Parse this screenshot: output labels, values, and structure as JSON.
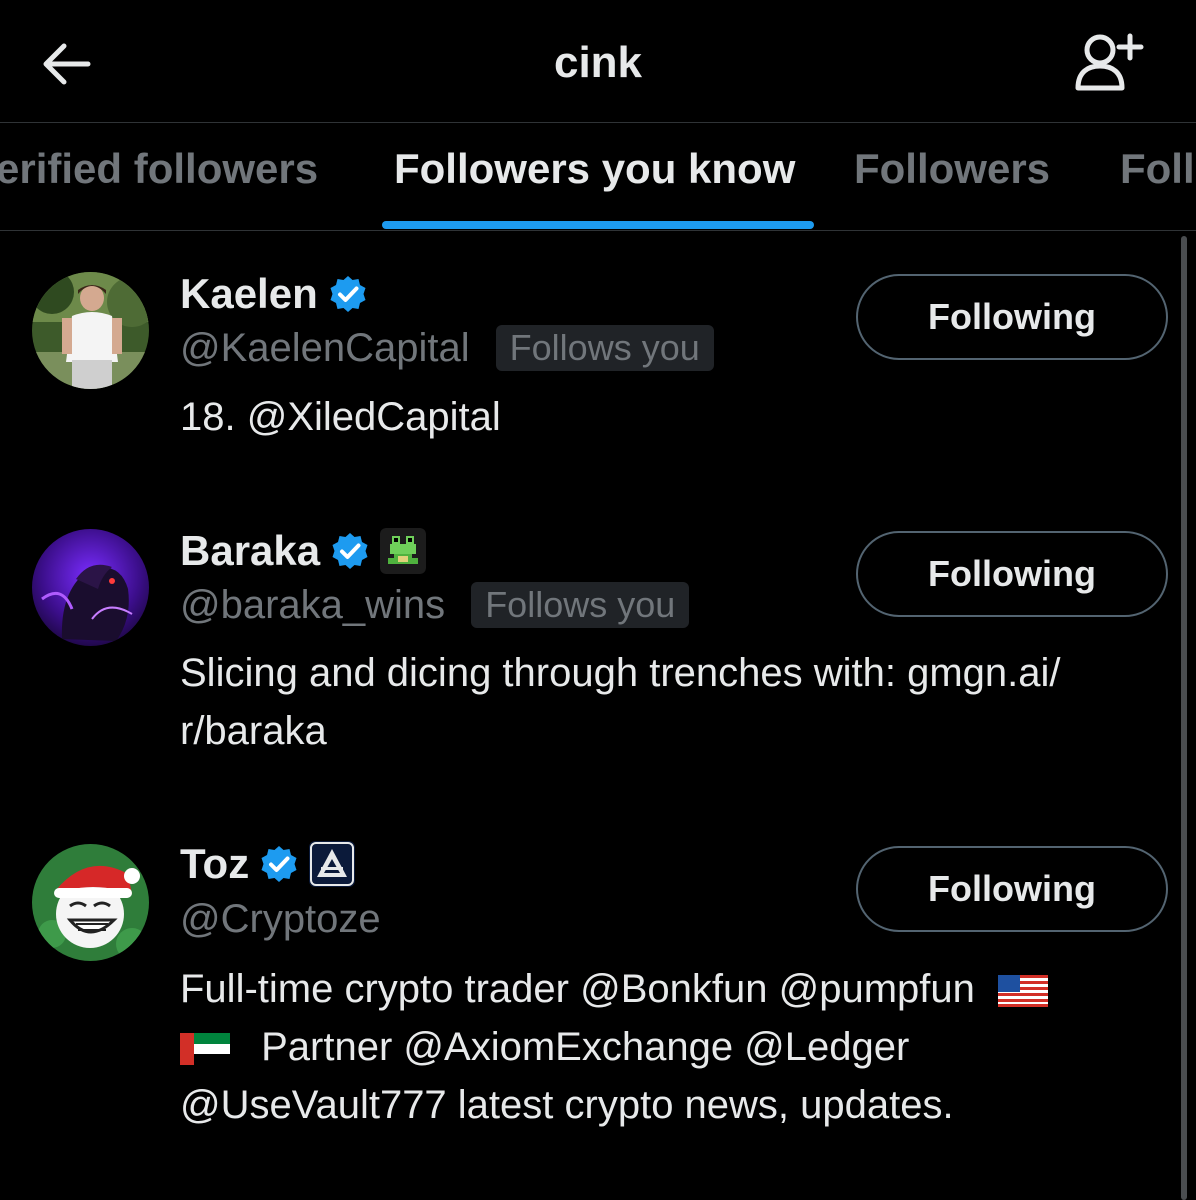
{
  "header": {
    "title": "cink",
    "back_icon": "arrow-left-icon",
    "add_icon": "add-user-icon"
  },
  "tabs": [
    {
      "label": "erified followers",
      "active": false
    },
    {
      "label": "Followers you know",
      "active": true
    },
    {
      "label": "Followers",
      "active": false
    },
    {
      "label": "Foll",
      "active": false
    }
  ],
  "colors": {
    "background": "#000000",
    "accent": "#1d9bf0",
    "text_primary": "#e7e9ea",
    "text_secondary": "#71767b",
    "verified": "#1d9bf0"
  },
  "users": [
    {
      "name": "Kaelen",
      "verified": true,
      "handle": "@KaelenCapital",
      "follows_you": "Follows you",
      "bio": "18. @XiledCapital",
      "button": "Following"
    },
    {
      "name": "Baraka",
      "verified": true,
      "affiliate_badge": "frog-badge-icon",
      "handle": "@baraka_wins",
      "follows_you": "Follows you",
      "bio_line1": "Slicing and dicing through trenches with: gmgn.ai/",
      "bio_line2": "r/baraka",
      "button": "Following"
    },
    {
      "name": "Toz",
      "verified": true,
      "affiliate_badge": "axiom-badge-icon",
      "handle": "@Cryptoze",
      "bio_line1": "Full-time crypto trader @Bonkfun @pumpfun",
      "bio_line2": "Partner @AxiomExchange @Ledger",
      "bio_line3": "@UseVault777 latest crypto news, updates.",
      "flags": [
        "us-flag-icon",
        "uae-flag-icon"
      ],
      "button": "Following"
    }
  ]
}
